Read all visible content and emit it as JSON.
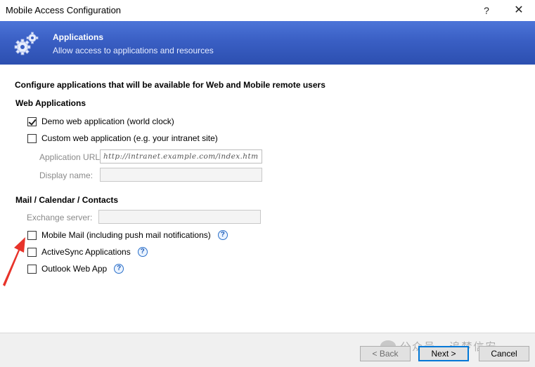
{
  "window": {
    "title": "Mobile Access Configuration",
    "help_glyph": "?",
    "close_glyph": "✕"
  },
  "banner": {
    "icon": "gears-icon",
    "title": "Applications",
    "subtitle": "Allow access to applications and resources",
    "colors": {
      "top": "#4c74d8",
      "bottom": "#2c4fb0"
    }
  },
  "main": {
    "instruction": "Configure applications that will be available for Web and Mobile remote users",
    "web_section": {
      "heading": "Web Applications",
      "demo": {
        "label": "Demo web application (world clock)",
        "checked": true
      },
      "custom": {
        "label": "Custom web application (e.g. your intranet site)",
        "checked": false
      },
      "app_url_label": "Application URL:",
      "app_url_placeholder": "http://intranet.example.com/index.htm",
      "display_name_label": "Display name:",
      "display_name_value": ""
    },
    "mail_section": {
      "heading": "Mail / Calendar / Contacts",
      "exchange_label": "Exchange server:",
      "exchange_value": "",
      "items": [
        {
          "label": "Mobile Mail (including push mail notifications)",
          "checked": false,
          "help": "?"
        },
        {
          "label": "ActiveSync Applications",
          "checked": false,
          "help": "?"
        },
        {
          "label": "Outlook Web App",
          "checked": false,
          "help": "?"
        }
      ]
    }
  },
  "footer": {
    "back_label": "< Back",
    "next_label": "Next >",
    "cancel_label": "Cancel",
    "watermark": "公众号 · 追梦信安"
  },
  "annotation": {
    "arrow_color": "#e8332a"
  }
}
